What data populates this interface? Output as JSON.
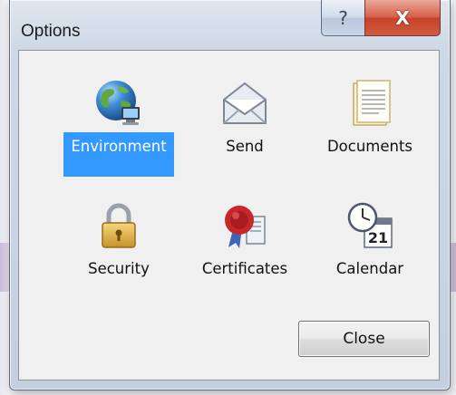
{
  "window": {
    "title": "Options",
    "help_glyph": "?",
    "close_glyph": "X"
  },
  "options": [
    {
      "label": "Environment",
      "icon": "globe-computer-icon",
      "selected": true
    },
    {
      "label": "Send",
      "icon": "envelope-icon",
      "selected": false
    },
    {
      "label": "Documents",
      "icon": "document-icon",
      "selected": false
    },
    {
      "label": "Security",
      "icon": "padlock-icon",
      "selected": false
    },
    {
      "label": "Certificates",
      "icon": "wax-seal-certificate-icon",
      "selected": false
    },
    {
      "label": "Calendar",
      "icon": "calendar-clock-icon",
      "selected": false
    }
  ],
  "footer": {
    "close_label": "Close"
  },
  "colors": {
    "selection": "#3399ff",
    "close_button_red": "#c7432a"
  }
}
